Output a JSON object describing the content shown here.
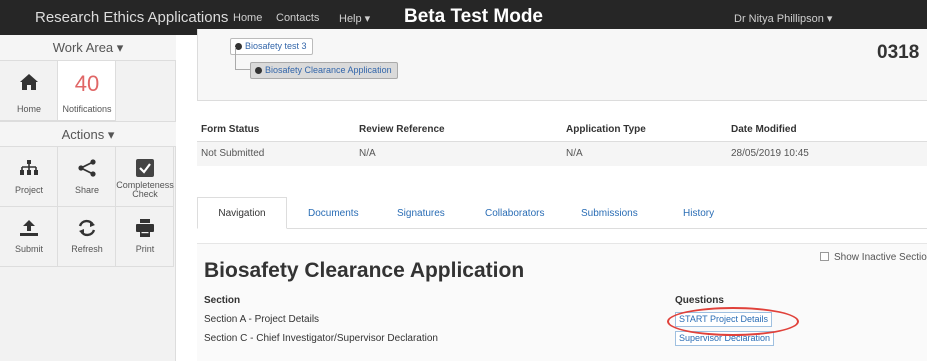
{
  "topbar": {
    "brand": "Research Ethics Applications",
    "nav": [
      "Home",
      "Contacts",
      "Help ▾"
    ],
    "mode_banner": "Beta Test Mode",
    "user": "Dr Nitya Phillipson ▾"
  },
  "sidebar": {
    "work_area_label": "Work Area ▾",
    "home_label": "Home",
    "notifications_count": "40",
    "notifications_label": "Notifications",
    "actions_label": "Actions ▾",
    "actions": [
      {
        "label": "Project",
        "icon": "sitemap-icon"
      },
      {
        "label": "Share",
        "icon": "share-icon"
      },
      {
        "label": "Completeness Check",
        "icon": "checkbox-icon"
      },
      {
        "label": "Submit",
        "icon": "upload-icon"
      },
      {
        "label": "Refresh",
        "icon": "refresh-icon"
      },
      {
        "label": "Print",
        "icon": "print-icon"
      }
    ]
  },
  "tree": {
    "parent": "Biosafety test 3",
    "child": "Biosafety Clearance Application",
    "reference": "0318"
  },
  "status": {
    "headers": [
      "Form Status",
      "Review Reference",
      "Application Type",
      "Date Modified"
    ],
    "values": [
      "Not Submitted",
      "N/A",
      "N/A",
      "28/05/2019 10:45"
    ]
  },
  "tabs": [
    "Navigation",
    "Documents",
    "Signatures",
    "Collaborators",
    "Submissions",
    "History"
  ],
  "form": {
    "title": "Biosafety Clearance Application",
    "show_inactive": "Show Inactive Section",
    "section_header": "Section",
    "questions_header": "Questions",
    "rows": [
      {
        "section": "Section A - Project Details",
        "question": "START Project Details"
      },
      {
        "section": "Section C - Chief Investigator/Supervisor Declaration",
        "question": "Supervisor Declaration"
      }
    ]
  },
  "colors": {
    "topbar": "#262626",
    "link": "#2a6db5",
    "notification": "#e06666",
    "highlight_circle": "#e0413a"
  }
}
